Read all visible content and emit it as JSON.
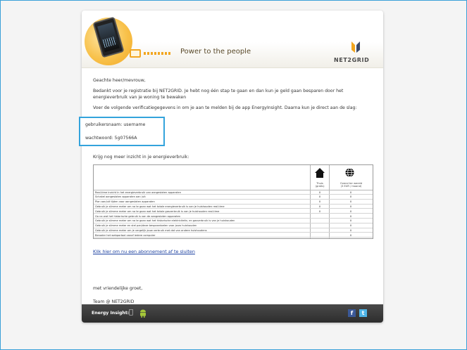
{
  "header": {
    "tagline": "Power to the people",
    "logo_text": "NET2GRID"
  },
  "email": {
    "greeting": "Geachte heer/mevrouw,",
    "intro_line1": "Bedankt voor je registratie bij NET2GRID. Je hebt nog één stap te gaan en dan kun je geld gaan besparen door het",
    "intro_line2": "energieverbruik van je woning te bewaken",
    "instructions": "Voer de volgende verificatiegegevens in om je aan te melden bij de app EnergyInsight. Daarna kun je direct aan de slag:",
    "username_line": "gebruikersnaam: username",
    "password_line": "wachtwoord: 5g07566A",
    "more_insight": "Krijg nog meer inzicht in je energieverbruik:",
    "link_text": "Klik hier om nu een abonnement af te sluiten",
    "closing": "met vriendelijke groet,",
    "signature": "Team @ NET2GRID"
  },
  "table": {
    "col1_label_line1": "Thuis",
    "col1_label_line2": "(gratis)",
    "col2_label_line1": "Overal ter wereld",
    "col2_label_line2": "(3 EUR / maand)",
    "rows": [
      {
        "label": "Real-time inzicht in het energieverbruik van aangesloten apparaten",
        "home": "X",
        "world": "X"
      },
      {
        "label": "Schakel aangesloten apparaten aan /uit",
        "home": "X",
        "world": "X"
      },
      {
        "label": "Plan aan/uit tijden voor aangesloten apparaten",
        "home": "X",
        "world": "X"
      },
      {
        "label": "Gebruik je slimme meter om na te gaan wat het totale energieverbruik is van je huishouden real-time",
        "home": "X",
        "world": "X"
      },
      {
        "label": "Gebruik je slimme meter om na te gaan wat het totale gasverbruik is van je huishouden real-time",
        "home": "X",
        "world": "X"
      },
      {
        "label": "Ga na wat het historische gebruik is van de aangesloten apparaten",
        "home": "",
        "world": "X"
      },
      {
        "label": "Gebruik je slimme meter om na te gaan wat het historische elektriciteits- en gasverbruik is van je huishouden",
        "home": "",
        "world": "X"
      },
      {
        "label": "Gebruik je slimme meter en stel pan/deze bespaardoelen voor jouw huishouden",
        "home": "",
        "world": "X"
      },
      {
        "label": "Gebruik je slimme meter om je vergelijk jouw verbruik met dat van andere huishoudens",
        "home": "",
        "world": "X"
      },
      {
        "label": "Benader het webportaal vanaf iedere computer",
        "home": "",
        "world": "X"
      }
    ]
  },
  "footer": {
    "label": "Energy Insight:",
    "facebook": "f",
    "twitter": "t"
  },
  "colors": {
    "highlight_border": "#33a3dc",
    "footer_bg": "#2d2d2d",
    "link": "#1a3fa0",
    "accent_orange": "#f2a620"
  },
  "icons": [
    "phone-icon",
    "meter-icon",
    "net2grid-logo-icon",
    "house-icon",
    "globe-icon",
    "apple-icon",
    "android-icon",
    "facebook-icon",
    "twitter-icon"
  ]
}
